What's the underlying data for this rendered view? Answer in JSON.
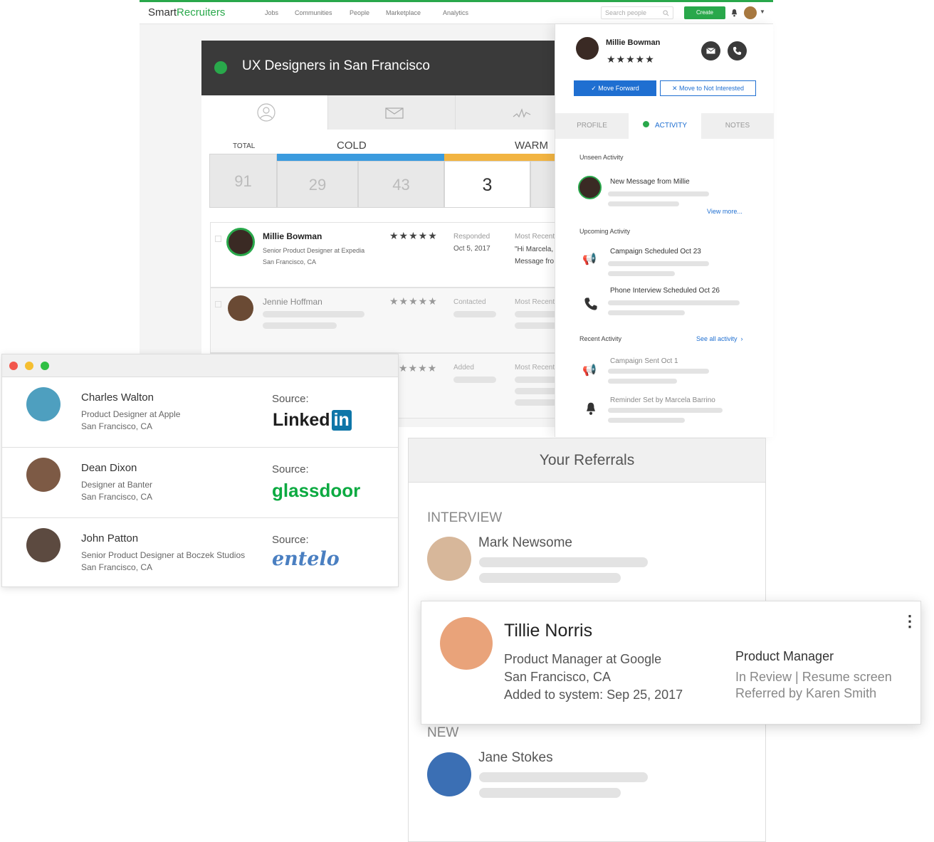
{
  "topbar": {
    "logo_main": "Smart",
    "logo_accent": "Recruiters",
    "nav": [
      "Jobs",
      "Communities",
      "People",
      "Marketplace",
      "Analytics"
    ],
    "search_placeholder": "Search people",
    "create_label": "Create"
  },
  "job": {
    "title": "UX Designers in San Francisco",
    "status_color": "#29a84b",
    "pipeline": {
      "total_label": "TOTAL",
      "cold_label": "COLD",
      "warm_label": "WARM",
      "total": "91",
      "cold_a": "29",
      "cold_b": "43",
      "warm": "3"
    },
    "candidates": [
      {
        "name": "Millie Bowman",
        "title": "Senior Product Designer at Expedia",
        "location": "San Francisco, CA",
        "stars": "★★★★★",
        "status": "Responded",
        "date": "Oct 5, 2017",
        "recent_label": "Most Recent",
        "recent_line1": "\"Hi Marcela,",
        "recent_line2": "Message fro"
      },
      {
        "name": "Jennie Hoffman",
        "stars": "★★★★★",
        "status": "Contacted",
        "recent_label": "Most Recent"
      },
      {
        "stars": "★★★★",
        "status": "Added",
        "recent_label": "Most Recent"
      }
    ]
  },
  "panel": {
    "name": "Millie Bowman",
    "stars": "★★★★★",
    "move_forward": "Move Forward",
    "not_interested": "Move to Not Interested",
    "tabs": [
      "PROFILE",
      "ACTIVITY",
      "NOTES"
    ],
    "unseen_label": "Unseen Activity",
    "unseen_item": "New Message from Millie",
    "view_more": "View more...",
    "upcoming_label": "Upcoming Activity",
    "upcoming": [
      "Campaign Scheduled Oct 23",
      "Phone Interview Scheduled Oct 26"
    ],
    "recent_label": "Recent Activity",
    "see_all": "See all activity",
    "recent": [
      "Campaign Sent Oct 1",
      "Reminder Set by Marcela Barrino"
    ]
  },
  "sources": {
    "source_label": "Source:",
    "rows": [
      {
        "name": "Charles Walton",
        "title": "Product Designer at Apple",
        "location": "San Francisco, CA",
        "source": "LinkedIn",
        "logo_text": "Linked",
        "logo_badge": "in"
      },
      {
        "name": "Dean Dixon",
        "title": "Designer at Banter",
        "location": "San Francisco, CA",
        "source": "glassdoor",
        "logo_text": "glassdoor"
      },
      {
        "name": "John Patton",
        "title": "Senior Product Designer at Boczek Studios",
        "location": "San Francisco, CA",
        "source": "entelo",
        "logo_text": "entelo"
      }
    ]
  },
  "referrals": {
    "title": "Your Referrals",
    "interview_label": "INTERVIEW",
    "interview_name": "Mark Newsome",
    "new_label": "NEW",
    "new_name": "Jane Stokes",
    "featured": {
      "name": "Tillie Norris",
      "title": "Product Manager at Google",
      "location": "San Francisco, CA",
      "added": "Added to system: Sep 25, 2017",
      "role": "Product Manager",
      "status": "In Review | Resume screen",
      "referred": "Referred by Karen Smith"
    }
  },
  "colors": {
    "brand_green": "#29a84b",
    "cold_blue": "#3b9bde",
    "warm_yellow": "#f2b441",
    "linkedin_blue": "#0e76a8",
    "glassdoor_green": "#0caa41",
    "entelo_blue": "#4a7fc1"
  }
}
